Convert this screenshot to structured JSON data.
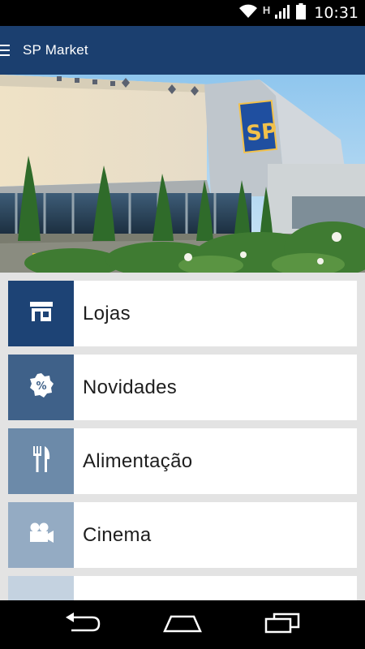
{
  "status_bar": {
    "time": "10:31",
    "network_label": "H",
    "icons": [
      "wifi-icon",
      "signal-icon",
      "battery-icon"
    ]
  },
  "action_bar": {
    "title": "SP Market",
    "menu_icon": "hamburger-icon"
  },
  "hero": {
    "image": "sp-market-building-photo",
    "sign_text": "SP"
  },
  "menu": {
    "items": [
      {
        "label": "Lojas",
        "icon": "storefront-icon",
        "color": "#1d4375"
      },
      {
        "label": "Novidades",
        "icon": "percent-badge-icon",
        "color": "#3f6189"
      },
      {
        "label": "Alimentação",
        "icon": "fork-knife-icon",
        "color": "#6c8aa9"
      },
      {
        "label": "Cinema",
        "icon": "movie-camera-icon",
        "color": "#94abc3"
      },
      {
        "label": "",
        "icon": "partial-icon",
        "color": "#c4d2e0"
      }
    ]
  },
  "nav_bar": {
    "buttons": [
      "back-icon",
      "home-icon",
      "recents-icon"
    ]
  },
  "colors": {
    "action_bar": "#1b3f6f",
    "background": "#e3e3e3"
  }
}
